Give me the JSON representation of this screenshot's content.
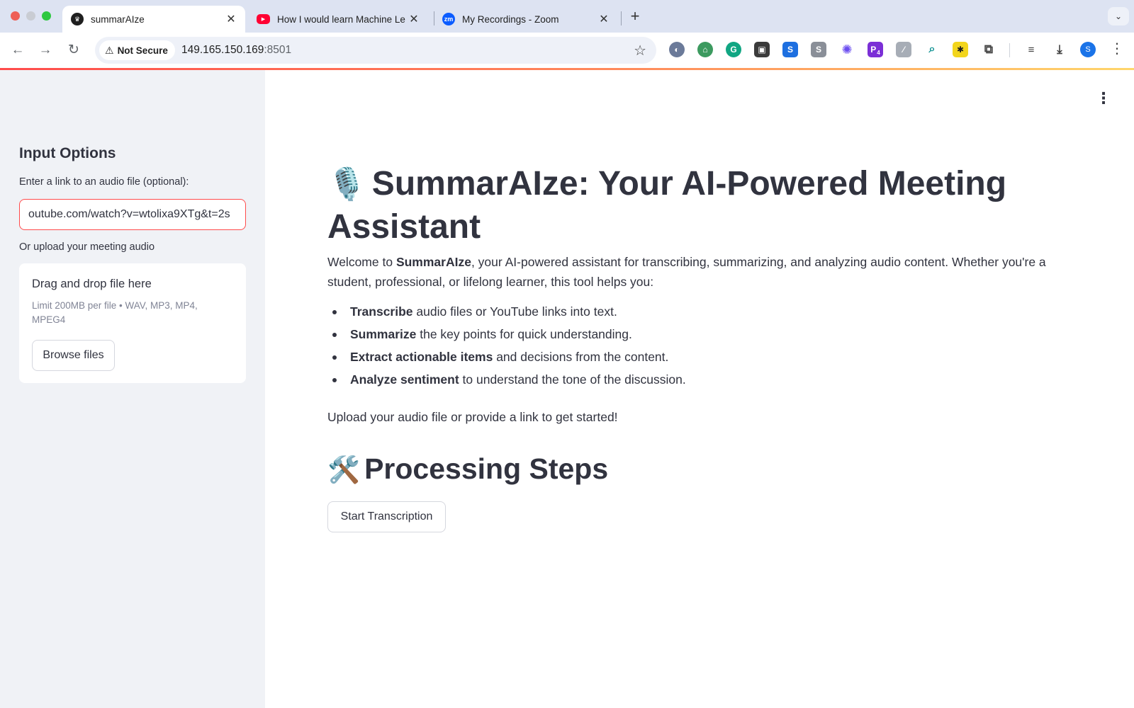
{
  "browser": {
    "tabs": [
      {
        "title": "summarAIze",
        "icon": "streamlit-crown-icon",
        "active": true
      },
      {
        "title": "How I would learn Machine Le",
        "icon": "youtube-icon",
        "active": false
      },
      {
        "title": "My Recordings - Zoom",
        "icon": "zoom-icon",
        "favicon_text": "zm",
        "active": false
      }
    ],
    "security_label": "Not Secure",
    "url_host": "149.165.150.169",
    "url_port": ":8501",
    "profile_initial": "S",
    "extension_badge": "4"
  },
  "sidebar": {
    "title": "Input Options",
    "link_label": "Enter a link to an audio file (optional):",
    "link_value": "outube.com/watch?v=wtolixa9XTg&t=2s",
    "upload_label": "Or upload your meeting audio",
    "dropzone": {
      "title": "Drag and drop file here",
      "limit_text": "Limit 200MB per file • WAV, MP3, MP4, MPEG4",
      "browse_label": "Browse files"
    }
  },
  "main": {
    "title_emoji": "🎙️",
    "title": "SummarAIze: Your AI-Powered Meeting Assistant",
    "intro_prefix": "Welcome to ",
    "intro_brand": "SummarAIze",
    "intro_suffix": ", your AI-powered assistant for transcribing, summarizing, and analyzing audio content. Whether you're a student, professional, or lifelong learner, this tool helps you:",
    "bullets": [
      {
        "bold": "Transcribe",
        "text": " audio files or YouTube links into text."
      },
      {
        "bold": "Summarize",
        "text": " the key points for quick understanding."
      },
      {
        "bold": "Extract actionable items",
        "text": " and decisions from the content."
      },
      {
        "bold": "Analyze sentiment",
        "text": " to understand the tone of the discussion."
      }
    ],
    "cta": "Upload your audio file or provide a link to get started!",
    "steps_emoji": "🛠️",
    "steps_heading": "Processing Steps",
    "start_button": "Start Transcription"
  },
  "colors": {
    "accent": "#ff4b4b",
    "sidebar_bg": "#f0f2f6",
    "text": "#31333f",
    "tabstrip_bg": "#dde3f2"
  }
}
